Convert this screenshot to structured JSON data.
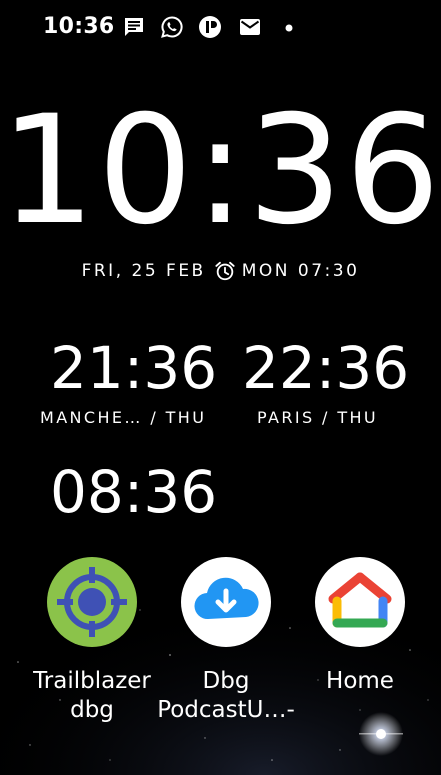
{
  "status_bar": {
    "time": "10:36",
    "notification_icons": [
      "message-icon",
      "whatsapp-icon",
      "app-icon",
      "gmail-icon",
      "more-dot-icon"
    ]
  },
  "clock": {
    "time": "10:36",
    "date": "FRI, 25 FEB",
    "alarm": "MON 07:30"
  },
  "world_clocks": [
    {
      "time": "21:36",
      "label": "MANCHE…  / THU"
    },
    {
      "time": "22:36",
      "label": "PARIS / THU"
    },
    {
      "time": "08:36",
      "label": ""
    }
  ],
  "apps": [
    {
      "label_line1": "Trailblazer",
      "label_line2": "dbg",
      "icon": "trailblazer-icon"
    },
    {
      "label_line1": "Dbg",
      "label_line2": "PodcastU…-",
      "icon": "cloud-download-icon"
    },
    {
      "label_line1": "Home",
      "label_line2": "",
      "icon": "google-home-icon"
    }
  ],
  "colors": {
    "background": "#000000",
    "text": "#ffffff",
    "trailblazer_green": "#8bc34a",
    "trailblazer_blue": "#3f51b5",
    "cloud_blue": "#2196f3"
  }
}
